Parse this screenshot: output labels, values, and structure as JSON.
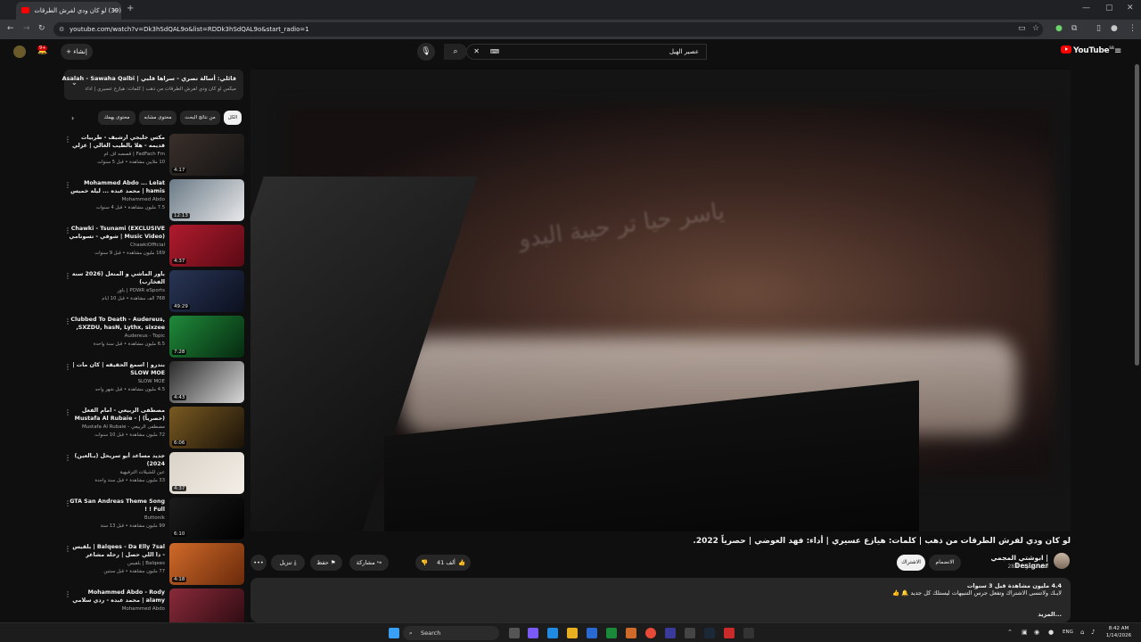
{
  "browser": {
    "tab_title": "(39) لو كان ودي لفرش الطرقات",
    "tab_close": "×",
    "new_tab": "+",
    "url": "youtube.com/watch?v=Dk3hSdQAL9o&list=RDDk3hSdQAL9o&start_radio=1",
    "window_min": "—",
    "window_max": "▢",
    "window_close": "✕"
  },
  "header": {
    "logo_text": "YouTube",
    "region": "SA",
    "search_query": "عصير الهيل",
    "create_label": "إنشاء",
    "notif_count": "9+"
  },
  "sidebar": {
    "now_playing_title": "قائلي: أسالة تصري - سراها قلبي | Asalah - Sawaha Qalbi",
    "now_playing_sub": "ميكس لو كان ودي لفرش الطرقات من ذهب | كلمات: هيازع عسيري | أداء: فهد الع...",
    "chips": [
      "الكل",
      "من نتائج البحث",
      "محتوى مشابه",
      "محتوى يهمك"
    ],
    "items": [
      {
        "title": "مكس خليجي ارشيف - طربيات قديمه - هلا بالطيب الغالي | غزلي جديد",
        "channel": "FadFach Fm | قصصه اف ام",
        "views": "10 ملايين مشاهدة • قبل 5 سنوات",
        "duration": "4:17",
        "color1": "#3a2f2a",
        "color2": "#141414"
      },
      {
        "title": "Mohammed Abdo ... Lelat hamis | محمد عبده ... ليلة خميس ، حفل",
        "channel": "Mohammed Abdo",
        "views": "7.5 مليون مشاهدة • قبل 4 سنوات",
        "duration": "12:13",
        "color1": "#6a7a86",
        "color2": "#e8e8ea"
      },
      {
        "title": "Chawki - Tsunami (EXCLUSIVE Music Video) | شوقي - تسونامي (فيديو",
        "channel": "ChawkiOfficial",
        "views": "169 مليون مشاهدة • قبل 9 سنوات",
        "duration": "4:37",
        "color1": "#b01b2e",
        "color2": "#5a0a14"
      },
      {
        "title": "باور الماشي و المنعل (2026 سنة الفخارب)",
        "channel": "POWR eSports | باور",
        "views": "768 ألف مشاهدة • قبل 10 أيام",
        "duration": "49:29",
        "color1": "#283554",
        "color2": "#0c1020"
      },
      {
        "title": "Clubbed To Death - Audereus, SXZDU, hasN, Lythx, sixzee, ...",
        "channel": "Audereus - Topic",
        "views": "6.5 مليون مشاهدة • قبل سنة واحدة",
        "duration": "7:28",
        "color1": "#1f8a3a",
        "color2": "#062a10"
      },
      {
        "title": "بندرو | اسمع الحقيقه | كان مات | SLOW MOE",
        "channel": "SLOW MOE",
        "views": "4.5 مليون مشاهدة • قبل شهر واحد",
        "duration": "4:43",
        "color1": "#2a2a2a",
        "color2": "#d8d8d8"
      },
      {
        "title": "مصطفى الربيعي - امام الفعل (حصرياً) | Mustafa Al Rubaie - 2015",
        "channel": "مصطفى الربيعي - Mustafa Al Rubaie",
        "views": "72 مليون مشاهدة • قبل 10 سنوات",
        "duration": "6:06",
        "color1": "#7a5a22",
        "color2": "#1a1208"
      },
      {
        "title": "جديد مساعد أبو سريحل (يـالعين) 2024)",
        "channel": "عين للشيلات الترفيهية",
        "views": "33 مليون مشاهدة • قبل سنة واحدة",
        "duration": "4:37",
        "color1": "#d9d2c8",
        "color2": "#f4eee6"
      },
      {
        "title": "GTA San Andreas Theme Song Full ! !",
        "channel": "Buttonik",
        "views": "99 مليون مشاهدة • قبل 13 سنة",
        "duration": "6:10",
        "color1": "#1c1c1c",
        "color2": "#000000"
      },
      {
        "title": "Balqees - Da Elly 7sal | بلقيس - دا اللي حصل | رحلة مشاعر",
        "channel": "Balqees | بلقيس",
        "views": "77 مليون مشاهدة • قبل سنتين",
        "duration": "4:18",
        "color1": "#d06a2a",
        "color2": "#6a2a0a"
      },
      {
        "title": "Mohammed Abdo - Rody alamy | محمد عبده - ردي سلامي | حفل",
        "channel": "Mohammed Abdo",
        "views": "",
        "duration": "",
        "color1": "#8a2a3a",
        "color2": "#2a0a10"
      }
    ]
  },
  "video": {
    "title": "لو كان ودي لفرش الطرقات من ذهب | كلمات: هيازع عسيري | أداء: فهد العوضي | حصرياً 2022.",
    "watermark": "ياسر حيا تر حيبة البدو",
    "channel_name": "ابوشتي المجمي | Designer",
    "channel_subs": "28.8 ألف مشترك",
    "subscribe_label": "الاشتراك",
    "join_label": "الانضمام",
    "likes": "41 ألف",
    "share_label": "مشاركة",
    "save_label": "حفظ",
    "download_label": "تنزيل",
    "more_label": "•••",
    "desc_meta": "4.4 مليون مشاهدة  قبل 3 سنوات",
    "desc_line": "لايـك ولاتنسى الاشتراك وتفعل جرس التنبيهات ليستلك كل جديد 🔔 👍",
    "desc_more": "...المزيد"
  },
  "taskbar": {
    "search_label": "Search",
    "lang": "ENG",
    "time": "8:42 AM",
    "date": "1/14/2026"
  },
  "colors": {
    "brand_red": "#ff0000",
    "bg": "#0f0f0f",
    "surface": "#272727"
  }
}
